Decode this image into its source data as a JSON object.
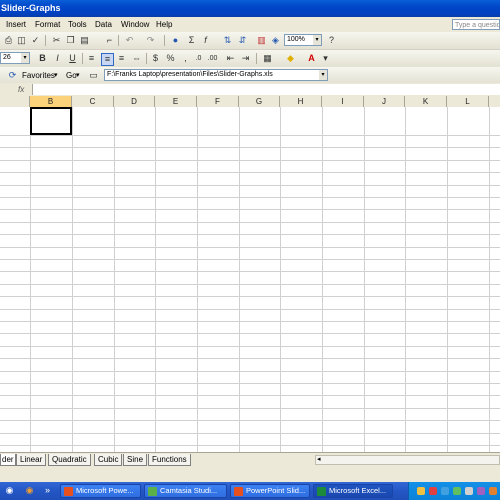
{
  "window": {
    "title": "Slider-Graphs"
  },
  "menu": {
    "items": [
      "Insert",
      "Format",
      "Tools",
      "Data",
      "Window",
      "Help"
    ],
    "ask_placeholder": "Type a questio"
  },
  "toolbar": {
    "zoom": "100%",
    "font_size": "26",
    "icons": [
      "print-icon",
      "preview-icon",
      "spelling-icon",
      "cut-icon",
      "copy-icon",
      "paste-icon",
      "format-painter-icon",
      "undo-icon",
      "redo-icon",
      "hyperlink-icon",
      "autosum-icon",
      "function-icon",
      "sort-ascending-icon",
      "sort-descending-icon",
      "chart-wizard-icon",
      "drawing-icon",
      "help-icon"
    ]
  },
  "web": {
    "favorites_label": "Favorites",
    "go_label": "Go",
    "address": "F:\\Franks Laptop\\presentation\\Files\\Slider-Graphs.xls"
  },
  "formula": {
    "fx": "fx"
  },
  "columns": [
    "B",
    "C",
    "D",
    "E",
    "F",
    "G",
    "H",
    "I",
    "J",
    "K",
    "L"
  ],
  "selected_column": "B",
  "sheets": {
    "tabs": [
      "der",
      "Linear",
      "Quadratic",
      "Cubic",
      "Sine",
      "Functions"
    ],
    "active": "der"
  },
  "taskbar": {
    "items": [
      {
        "label": "Microsoft Powe...",
        "color": "#e8501e"
      },
      {
        "label": "Camtasia Studi...",
        "color": "#5ab04a"
      },
      {
        "label": "PowerPoint Slid...",
        "color": "#e8501e"
      },
      {
        "label": "Microsoft Excel...",
        "color": "#1e8a3c"
      }
    ]
  },
  "colors": {
    "title_bar": "#0046c8",
    "taskbar": "#245edb",
    "selection": "#000000"
  }
}
